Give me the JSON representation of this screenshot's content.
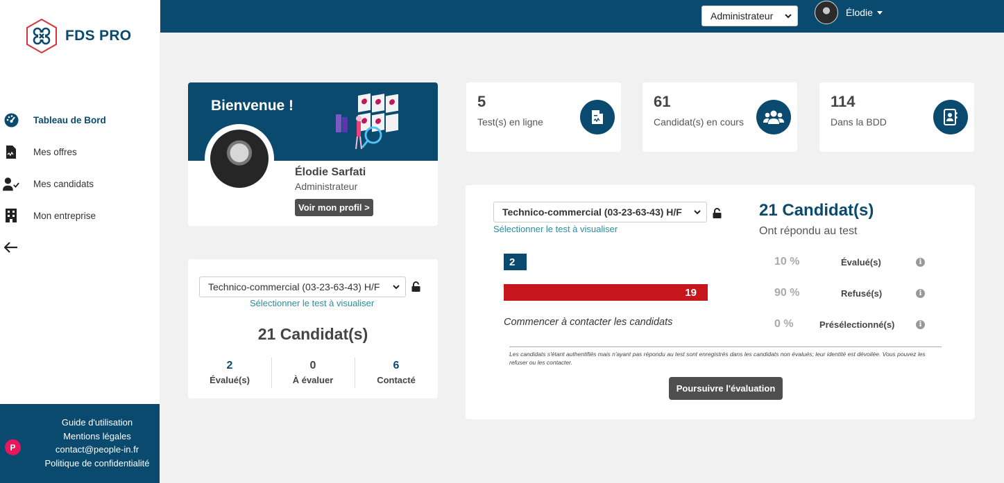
{
  "app": {
    "name": "FDS PRO"
  },
  "sidebar": {
    "items": [
      {
        "label": "Tableau de Bord",
        "icon": "dashboard-icon",
        "active": true
      },
      {
        "label": "Mes offres",
        "icon": "document-icon"
      },
      {
        "label": "Mes candidats",
        "icon": "user-check-icon"
      },
      {
        "label": "Mon entreprise",
        "icon": "building-icon"
      }
    ],
    "back_icon": "arrow-left-icon"
  },
  "footer": {
    "links": [
      "Guide d'utilisation",
      "Mentions légales",
      "contact@people-in.fr",
      "Politique de confidentialité"
    ],
    "badge": "P"
  },
  "header": {
    "role_select": {
      "value": "Administrateur"
    },
    "user_name": "Élodie"
  },
  "welcome": {
    "title": "Bienvenue !",
    "name": "Élodie Sarfati",
    "role": "Administrateur",
    "profile_button": "Voir mon profil >"
  },
  "stats": [
    {
      "value": "5",
      "label": "Test(s) en ligne",
      "icon": "test-file-icon"
    },
    {
      "value": "61",
      "label": "Candidat(s) en cours",
      "icon": "users-icon"
    },
    {
      "value": "114",
      "label": "Dans la BDD",
      "icon": "contact-book-icon"
    }
  ],
  "test_left": {
    "select_value": "Technico-commercial (03-23-63-43) H/F",
    "select_hint": "Sélectionner le test à visualiser",
    "candidates": "21 Candidat(s)",
    "mini_stats": [
      {
        "value": "2",
        "label": "Évalué(s)"
      },
      {
        "value": "0",
        "label": "À évaluer"
      },
      {
        "value": "6",
        "label": "Contacté"
      }
    ]
  },
  "test_right": {
    "select_value": "Technico-commercial (03-23-63-43) H/F",
    "select_hint": "Sélectionner le test à visualiser",
    "candidates": "21 Candidat(s)",
    "subtitle": "Ont répondu au test",
    "rows": [
      {
        "count": "2",
        "percent": "10 %",
        "label": "Évalué(s)",
        "fraction": 0.1,
        "color": "#0b4a6f"
      },
      {
        "count": "19",
        "percent": "90 %",
        "label": "Refusé(s)",
        "fraction": 0.9,
        "color": "#c8161d"
      },
      {
        "text": "Commencer à contacter les candidats",
        "percent": "0 %",
        "label": "Présélectionné(s)",
        "fraction": 0
      }
    ],
    "note": "Les candidats s'étant authentifiés mais n'ayant pas répondu au test sont enregistrés dans les candidats non évalués; leur identité est dévoilée. Vous pouvez les refuser ou les contacter.",
    "continue_button": "Poursuivre l'évaluation"
  },
  "colors": {
    "primary": "#0b4a6f",
    "danger": "#c8161d",
    "accent": "#2a8c9e",
    "badge": "#e8175d"
  }
}
